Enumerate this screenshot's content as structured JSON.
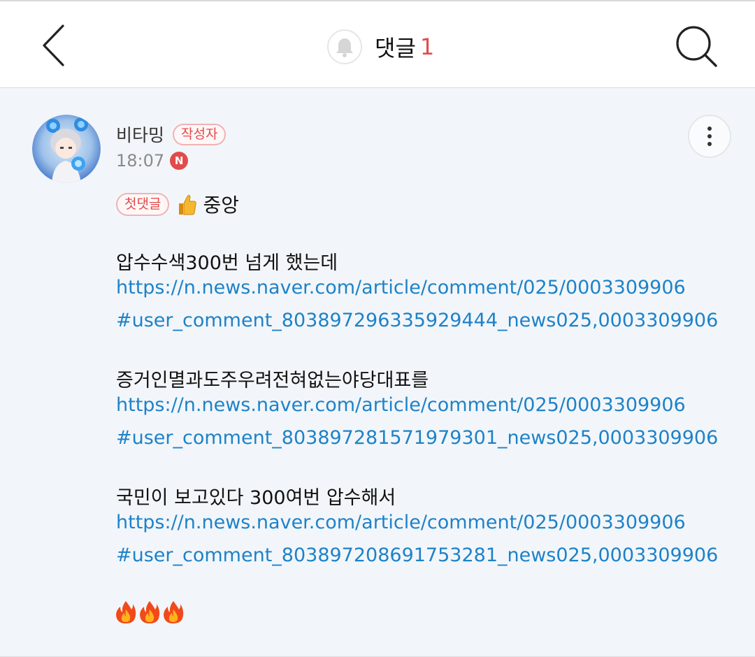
{
  "header": {
    "title": "댓글",
    "count": "1",
    "accent_color": "#e24b4b",
    "icons": [
      "back-arrow-icon",
      "bell-icon",
      "search-icon"
    ]
  },
  "comment": {
    "author": "비타밍",
    "author_badge": "작성자",
    "time": "18:07",
    "new_badge": "N",
    "first_badge": "첫댓글",
    "first_text": "중앙",
    "paragraphs": [
      {
        "text": "압수수색300번 넘게 했는데",
        "link_line1": "https://n.news.naver.com/article/comment/025/0003309906",
        "link_line2": "#user_comment_803897296335929444_news025,0003309906"
      },
      {
        "text": "증거인멸과도주우려전혀없는야당대표를",
        "link_line1": "https://n.news.naver.com/article/comment/025/0003309906",
        "link_line2": "#user_comment_803897281571979301_news025,0003309906"
      },
      {
        "text": "국민이 보고있다 300여번 압수해서",
        "link_line1": "https://n.news.naver.com/article/comment/025/0003309906",
        "link_line2": "#user_comment_803897208691753281_news025,0003309906"
      }
    ],
    "link_color": "#1e82c8",
    "background": "#f2f6fa",
    "fire_count": 3
  }
}
